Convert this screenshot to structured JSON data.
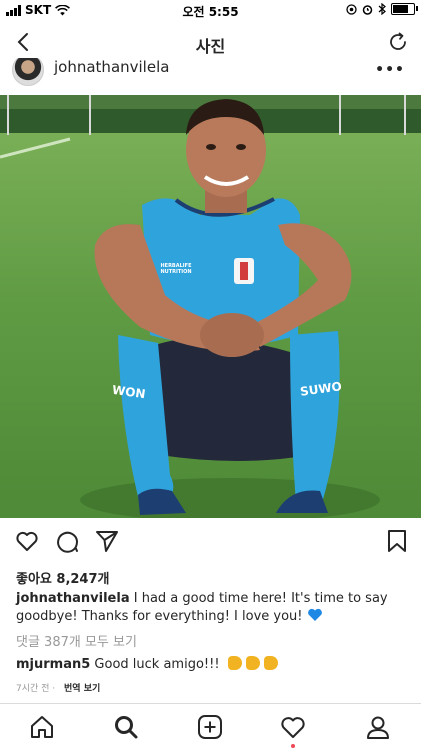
{
  "status": {
    "carrier": "SKT",
    "time": "오전 5:55",
    "battery_level": 0.85
  },
  "nav": {
    "title": "사진"
  },
  "post": {
    "username": "johnathanvilela",
    "likes_text": "좋아요 8,247개",
    "caption_username": "johnathanvilela",
    "caption_text": " I had a good time here! It's time to say goodbye! Thanks for everything! I love you! ",
    "view_comments": "댓글 387개 모두 보기",
    "comment": {
      "username": "mjurman5",
      "text": " Good luck amigo!!! "
    },
    "time_ago": "7시간 전",
    "separator": " · ",
    "translate_label": "번역 보기",
    "photo_texts": {
      "sponsor": "HERBALIFE NUTRITION",
      "sock_left": "WON",
      "sock_right": "SUWO"
    }
  },
  "icons": [
    "back-icon",
    "refresh-icon",
    "more-icon",
    "heart-icon",
    "comment-icon",
    "share-icon",
    "bookmark-icon",
    "home-icon",
    "search-icon",
    "add-icon",
    "activity-icon",
    "profile-icon",
    "emoji-fist-icon",
    "blue-heart-icon"
  ],
  "colors": {
    "accent_notification": "#ed4956",
    "muted_text": "#999999",
    "jersey": "#2fa3dc"
  }
}
